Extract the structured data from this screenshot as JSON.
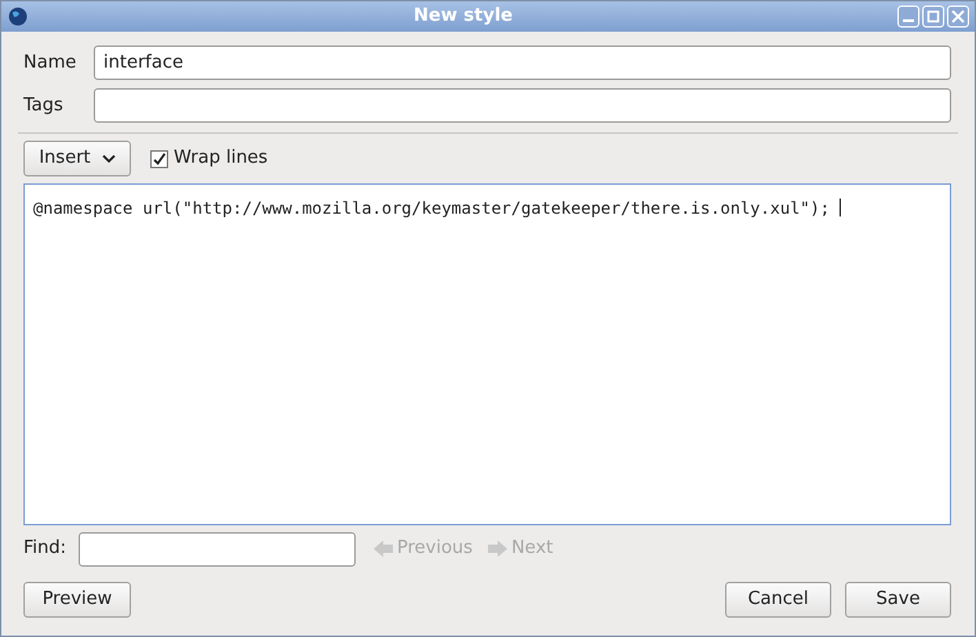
{
  "window": {
    "title": "New style"
  },
  "name_field": {
    "label": "Name",
    "value": "interface"
  },
  "tags_field": {
    "label": "Tags"
  },
  "insert_button": {
    "label": "Insert"
  },
  "wrap_lines": {
    "label": "Wrap lines",
    "checked": true
  },
  "editor": {
    "text": "@namespace url(\"http://www.mozilla.org/keymaster/gatekeeper/there.is.only.xul\");"
  },
  "find": {
    "label": "Find:",
    "previous": {
      "label": "Previous",
      "disabled": true
    },
    "next": {
      "label": "Next",
      "disabled": true
    }
  },
  "buttons": {
    "preview": "Preview",
    "cancel": "Cancel",
    "save": "Save"
  }
}
